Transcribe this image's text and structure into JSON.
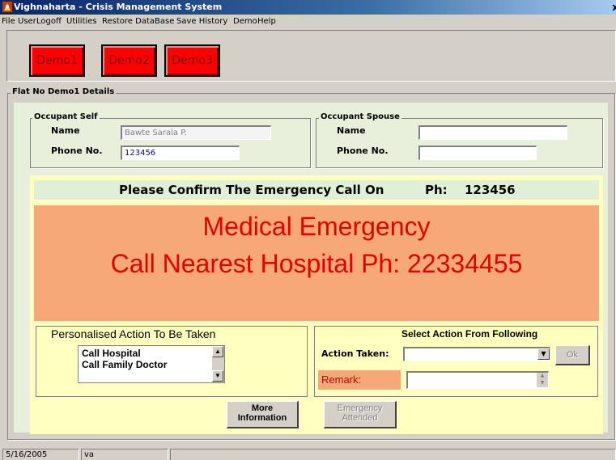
{
  "window": {
    "title": "Vighnaharta - Crisis Management System",
    "close_glyph": "x"
  },
  "menu": [
    "File",
    "User",
    "Logoff",
    "Utilities",
    "Restore DataBase",
    "Save History",
    "Demo",
    "Help"
  ],
  "toolbar": {
    "buttons": [
      "Demo1",
      "Demo2",
      "Demo3"
    ]
  },
  "flat": {
    "legend": "Flat No Demo1 Details"
  },
  "occupant_self": {
    "legend": "Occupant Self",
    "name_label": "Name",
    "name_value": "Bawte Sarala P.",
    "phone_label": "Phone No.",
    "phone_value": "123456"
  },
  "occupant_spouse": {
    "legend": "Occupant Spouse",
    "name_label": "Name",
    "name_value": "",
    "phone_label": "Phone No.",
    "phone_value": ""
  },
  "confirm": {
    "text": "Please Confirm The Emergency  Call On",
    "ph_label": "Ph:",
    "ph_value": "123456"
  },
  "alert": {
    "line1": "Medical Emergency",
    "line2": "Call Nearest Hospital Ph: 22334455"
  },
  "personalised": {
    "title": "Personalised Action To Be Taken",
    "items": [
      "Call Hospital",
      "Call Family Doctor"
    ]
  },
  "select_action": {
    "title": "Select Action From Following",
    "action_label": "Action  Taken:",
    "action_value": "",
    "ok_label": "Ok",
    "remark_label": "Remark:",
    "remark_value": ""
  },
  "buttons": {
    "more_info_line1": "More",
    "more_info_line2": "Information",
    "attended_line1": "Emergency",
    "attended_line2": "Attended"
  },
  "status": {
    "date": "5/16/2005",
    "user": "va"
  },
  "colors": {
    "demo_button": "#ff0000",
    "alert_bg": "#f6a878",
    "alert_text": "#e00000",
    "panel_bg": "#ffffc0"
  }
}
